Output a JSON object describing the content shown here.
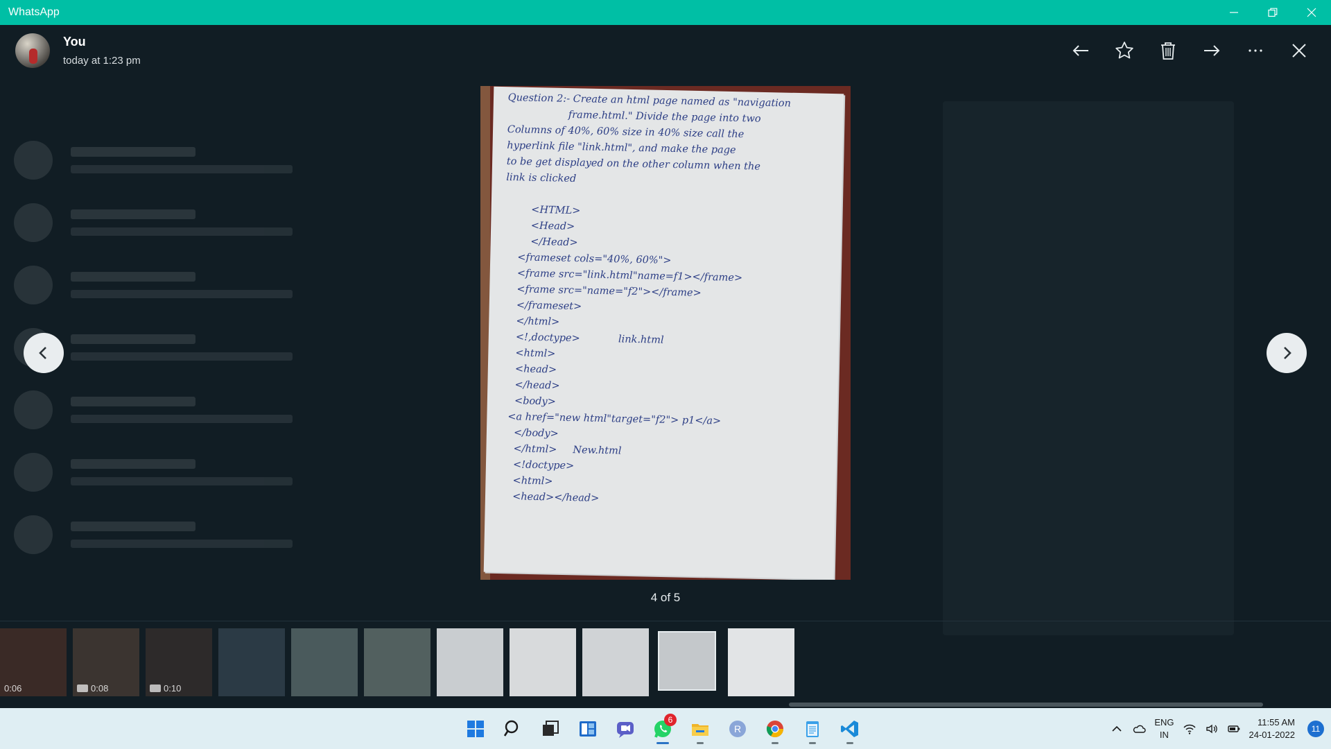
{
  "window": {
    "app_title": "WhatsApp",
    "controls": [
      "minimize",
      "restore",
      "close"
    ]
  },
  "header": {
    "sender": "You",
    "timestamp": "today at 1:23 pm",
    "actions": [
      {
        "name": "back-arrow-icon",
        "label": "Back"
      },
      {
        "name": "star-icon",
        "label": "Star"
      },
      {
        "name": "delete-icon",
        "label": "Delete"
      },
      {
        "name": "forward-arrow-icon",
        "label": "Forward"
      },
      {
        "name": "more-icon",
        "label": "More options"
      },
      {
        "name": "close-icon",
        "label": "Close"
      }
    ]
  },
  "viewer": {
    "counter": "4 of 5",
    "handwritten_text": "Question 2:- Create an html page named as \"navigation\n                   frame.html.\" Divide the page into two\nColumns of 40%, 60% size in 40% size call the\nhyperlink file \"link.html\", and make the page\nto be get displayed on the other column when the\nlink is clicked\n\n        <HTML>\n        <Head>\n        </Head>\n    <frameset cols=\"40%, 60%\">\n    <frame src=\"link.html\"name=f1></frame>\n    <frame src=\"name=\"f2\"></frame>\n    </frameset>\n    </html>\n    <!,doctype>            link.html\n    <html>\n    <head>\n    </head>\n    <body>\n  <a href=\"new html\"target=\"f2\"> p1</a>\n    </body>\n    </html>     New.html\n    <!doctype>\n    <html>\n    <head></head>"
  },
  "thumbnails": [
    {
      "kind": "video",
      "duration": "0:06",
      "tone": "#3a2a26"
    },
    {
      "kind": "video",
      "duration": "0:08",
      "tone": "#3b3430"
    },
    {
      "kind": "video",
      "duration": "0:10",
      "tone": "#2d2a2a"
    },
    {
      "kind": "image",
      "duration": "",
      "tone": "#2b3a45"
    },
    {
      "kind": "image",
      "duration": "",
      "tone": "#4a5a5c"
    },
    {
      "kind": "image",
      "duration": "",
      "tone": "#52605f"
    },
    {
      "kind": "image",
      "duration": "",
      "tone": "#c9cdd0"
    },
    {
      "kind": "image",
      "duration": "",
      "tone": "#d8dadc"
    },
    {
      "kind": "image",
      "duration": "",
      "tone": "#d0d3d6"
    },
    {
      "kind": "image",
      "duration": "",
      "tone": "#c4c8cb",
      "selected": true
    },
    {
      "kind": "image",
      "duration": "",
      "tone": "#e2e4e6"
    }
  ],
  "taskbar": {
    "apps": [
      {
        "name": "start-icon"
      },
      {
        "name": "search-icon"
      },
      {
        "name": "task-view-icon"
      },
      {
        "name": "widgets-icon"
      },
      {
        "name": "teams-chat-icon"
      },
      {
        "name": "whatsapp-icon",
        "badge": "6",
        "active": true
      },
      {
        "name": "file-explorer-icon",
        "running": true
      },
      {
        "name": "r-app-icon"
      },
      {
        "name": "chrome-icon",
        "running": true
      },
      {
        "name": "notepad-icon",
        "running": true
      },
      {
        "name": "vscode-icon",
        "running": true
      }
    ],
    "tray": {
      "lang_top": "ENG",
      "lang_bottom": "IN",
      "time": "11:55 AM",
      "date": "24-01-2022",
      "notifications": "11"
    }
  },
  "colors": {
    "titlebar": "#00bfa5",
    "viewer_bg": "#111d24",
    "ink": "#2c3e85",
    "badge": "#e0242c"
  }
}
